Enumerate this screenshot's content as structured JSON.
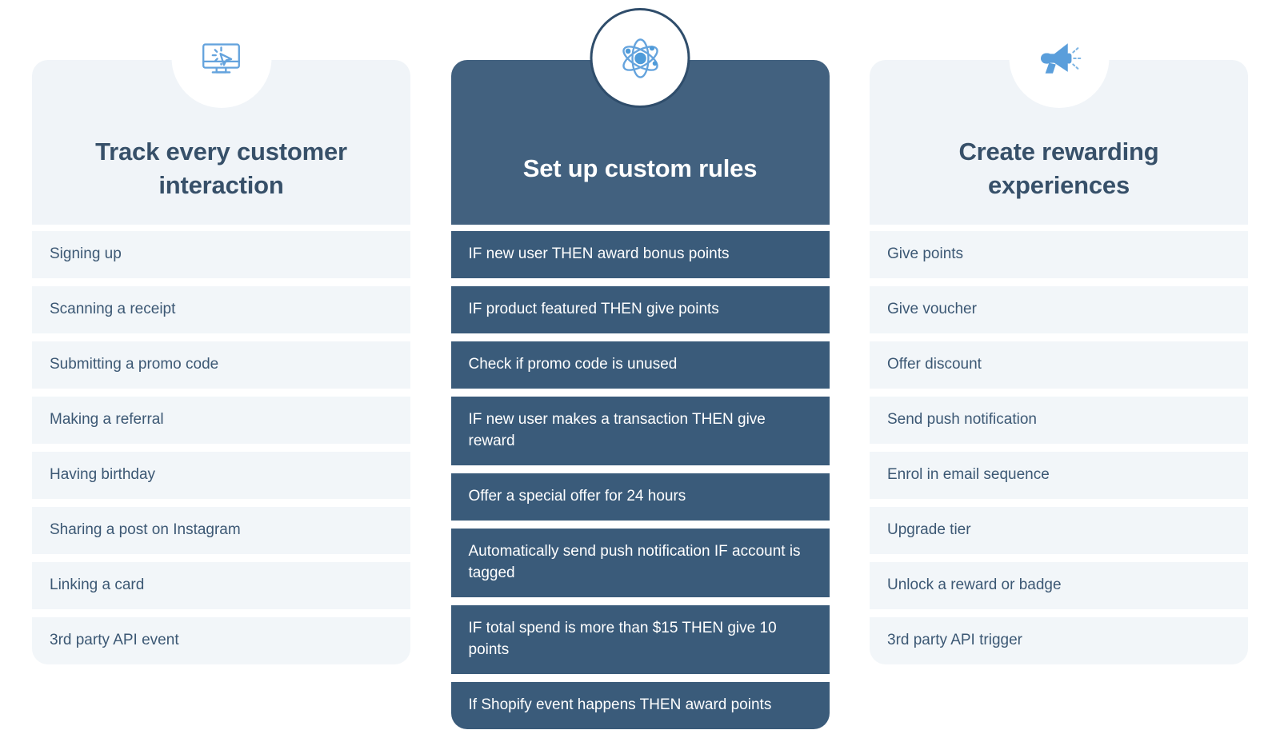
{
  "columns": [
    {
      "id": "track",
      "icon": "monitor-click-icon",
      "title": "Track every customer interaction",
      "theme": "light",
      "items": [
        "Signing up",
        "Scanning a receipt",
        "Submitting a promo code",
        "Making a referral",
        "Having birthday",
        "Sharing a post on Instagram",
        "Linking a card",
        "3rd party API event"
      ]
    },
    {
      "id": "rules",
      "icon": "atom-icon",
      "title": "Set up custom rules",
      "theme": "dark",
      "items": [
        "IF new user THEN award bonus points",
        "IF product featured THEN give points",
        "Check if promo code is unused",
        "IF new user makes a transaction THEN give reward",
        "Offer a special offer for 24 hours",
        "Automatically send push notification IF account is tagged",
        "IF total spend is more than $15 THEN give 10 points",
        "If Shopify event happens THEN award points"
      ]
    },
    {
      "id": "rewards",
      "icon": "megaphone-icon",
      "title": "Create rewarding experiences",
      "theme": "light",
      "items": [
        "Give points",
        "Give voucher",
        "Offer discount",
        "Send push notification",
        "Enrol in email sequence",
        "Upgrade tier",
        "Unlock a reward or badge",
        "3rd party API trigger"
      ]
    }
  ],
  "colors": {
    "page_background": "#ffffff",
    "light_panel": "#f0f4f8",
    "light_row": "#f2f6f9",
    "dark_panel": "#42617f",
    "dark_row": "#3a5b7a",
    "heading_text": "#375069",
    "body_text": "#3c5874",
    "icon_accent": "#64a3dd",
    "icon_ring": "#2f4d6b"
  }
}
